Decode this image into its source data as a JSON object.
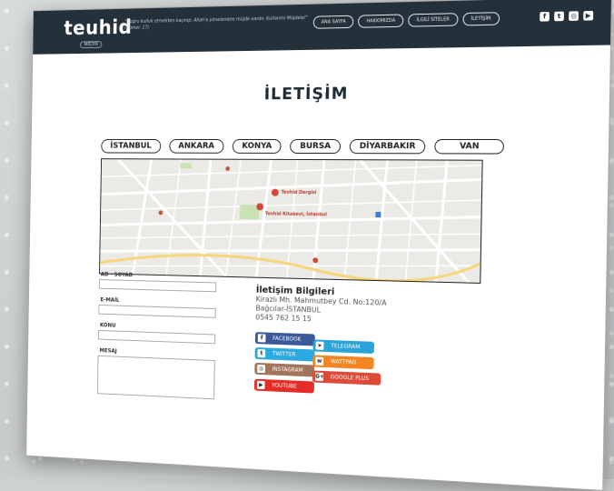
{
  "header": {
    "logo": "teuhid",
    "logo_sub": "MEDYA",
    "tagline": "\"Doğru kulluk etmekten kaçınıp, Allah'a yönelenlere müjde vardır. Kullarımı Müjdele!\" (Zümer, 17)",
    "nav": [
      "ANA SAYFA",
      "HAKKIMIZDA",
      "İLGİLİ SİTELER",
      "İLETİŞİM"
    ],
    "social_icons": [
      "facebook-icon",
      "twitter-icon",
      "instagram-icon",
      "youtube-icon"
    ]
  },
  "page_title": "İLETİŞİM",
  "cities": [
    "İSTANBUL",
    "ANKARA",
    "KONYA",
    "BURSA",
    "DİYARBAKIR",
    "VAN"
  ],
  "map": {
    "pin1": "Tevhid Dergisi",
    "pin2": "Tevhid Kitabevi, İstanbul"
  },
  "form": {
    "name_label": "AD - SOYAD",
    "email_label": "E-MAİL",
    "subject_label": "KONU",
    "message_label": "MESAJ"
  },
  "contact": {
    "title": "İletişim Bilgileri",
    "address1": "Kirazlı Mh. Mahmutbey Cd. No:120/A",
    "address2": "Bağcılar-İSTANBUL",
    "phone": "0545 762 15 15"
  },
  "social_buttons": [
    {
      "label": "FACEBOOK",
      "icon": "f",
      "color": "#3b5998"
    },
    {
      "label": "TELEGRAM",
      "icon": "➤",
      "color": "#2aa3d8"
    },
    {
      "label": "TWITTER",
      "icon": "t",
      "color": "#2ba9e1"
    },
    {
      "label": "WATTPAD",
      "icon": "w",
      "color": "#f18622"
    },
    {
      "label": "INSTAGRAM",
      "icon": "◎",
      "color": "#a0755c"
    },
    {
      "label": "GOOGLE PLUS",
      "icon": "G+",
      "color": "#dc4a38"
    },
    {
      "label": "YOUTUBE",
      "icon": "▶",
      "color": "#e52d27"
    }
  ]
}
